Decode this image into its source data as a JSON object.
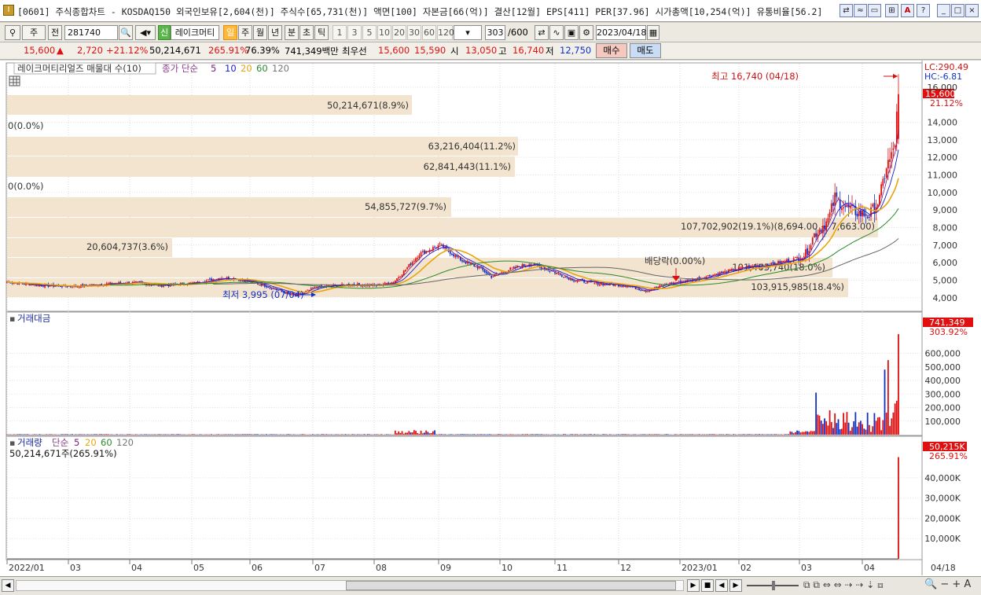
{
  "window": {
    "title": "[0601] 주식종합차트 - KOSDAQ150 외국인보유[2,604(천)] 주식수[65,731(천)] 액면[100] 자본금[66(억)] 결산[12월] EPS[411] PER[37.96] 시가총액[10,254(억)] 유통비율[56.2]",
    "buttons": [
      "⇄",
      "≈",
      "▭",
      "⊞",
      "A",
      "?"
    ],
    "controls": [
      "_",
      "□",
      "×"
    ]
  },
  "toolbar": {
    "mode": "주",
    "prev": "전",
    "code": "281740",
    "stock_name": "레이크머티",
    "badge": "신",
    "periods": [
      "일",
      "주",
      "월",
      "년",
      "분",
      "초",
      "틱"
    ],
    "selected_period": "일",
    "intervals": [
      "1",
      "3",
      "5",
      "10",
      "20",
      "30",
      "60",
      "120"
    ],
    "count": "303",
    "count_total": "/600",
    "date": "2023/04/18"
  },
  "quote": {
    "price": "15,600",
    "arrow": "▲",
    "change": "2,720",
    "change_pct": "+21.12%",
    "volume": "50,214,671",
    "vol_pct": "265.91%",
    "turnover": "76.39%",
    "amount": "741,349백만",
    "best_label": "최우선",
    "best_ask": "15,600",
    "best_bid": "15,590",
    "open_label": "시",
    "open": "13,050",
    "high_label": "고",
    "high": "16,740",
    "low_label": "저",
    "low": "12,750",
    "buy": "매수",
    "sell": "매도"
  },
  "colors": {
    "up": "#e01010",
    "down": "#1030c8",
    "ma5": "#1a1ad0",
    "ma20": "#e8a40c",
    "ma60": "#2a8a2a",
    "ma120": "#666666",
    "vp_band": "#f3e4d0"
  },
  "price_panel": {
    "legend_title": "레이크머티리얼즈 매물대 수(10)",
    "legend_ma_label": "종가 단순",
    "legend_ma": [
      "5",
      "10",
      "20",
      "60",
      "120"
    ],
    "lc": "LC:290.49",
    "hc": "HC:-6.81",
    "last_price": "15,600",
    "last_pct": "21.12%",
    "high_note": "최고 16,740 (04/18)",
    "low_note": "최저 3,995 (07/04)",
    "div_note": "배당락(0.00%)",
    "y_ticks": [
      "16,000",
      "14,000",
      "13,000",
      "12,000",
      "11,000",
      "10,000",
      "9,000",
      "8,000",
      "7,000",
      "6,000",
      "5,000",
      "4,000"
    ],
    "vp_labels": [
      "50,214,671(8.9%)",
      "0(0.0%)",
      "63,216,404(11.2%)",
      "62,841,443(11.1%)",
      "0(0.0%)",
      "54,855,727(9.7%)",
      "107,702,902(19.1%)(8,694.00 ~ 7,663.00)",
      "20,604,737(3.6%)",
      "101,463,740(18.0%)",
      "103,915,985(18.4%)"
    ]
  },
  "amount_panel": {
    "title": "거래대금",
    "last": "741,349",
    "last_pct": "303.92%",
    "y_ticks": [
      "600,000",
      "500,000",
      "400,000",
      "300,000",
      "200,000",
      "100,000"
    ]
  },
  "volume_panel": {
    "title": "거래량",
    "ma_label": "단순",
    "ma": [
      "5",
      "20",
      "60",
      "120"
    ],
    "info": "50,214,671주(265.91%)",
    "last": "50,215K",
    "last_pct": "265.91%",
    "y_ticks": [
      "40,000K",
      "30,000K",
      "20,000K",
      "10,000K"
    ]
  },
  "x_axis": {
    "labels": [
      "2022/01",
      "03",
      "04",
      "05",
      "06",
      "07",
      "08",
      "09",
      "10",
      "11",
      "12",
      "2023/01",
      "02",
      "03",
      "04"
    ],
    "end_label": "04/18"
  },
  "chart_data": {
    "type": "candlestick",
    "price_range": [
      3900,
      16800
    ],
    "highlights": {
      "high": 16740,
      "high_date": "04/18",
      "low": 3995,
      "low_date": "07/04"
    },
    "last_candle": {
      "open": 13050,
      "high": 16740,
      "low": 12750,
      "close": 15600
    },
    "volume_profile": [
      {
        "value": 50214671,
        "pct": 8.9
      },
      {
        "value": 0,
        "pct": 0.0
      },
      {
        "value": 63216404,
        "pct": 11.2
      },
      {
        "value": 62841443,
        "pct": 11.1
      },
      {
        "value": 0,
        "pct": 0.0
      },
      {
        "value": 54855727,
        "pct": 9.7
      },
      {
        "value": 107702902,
        "pct": 19.1,
        "range": [
          8694,
          7663
        ]
      },
      {
        "value": 20604737,
        "pct": 3.6
      },
      {
        "value": 101463740,
        "pct": 18.0
      },
      {
        "value": 103915985,
        "pct": 18.4
      }
    ],
    "price_anchors": [
      [
        0,
        4900
      ],
      [
        20,
        4700
      ],
      [
        40,
        4650
      ],
      [
        60,
        4800
      ],
      [
        75,
        4850
      ],
      [
        90,
        4700
      ],
      [
        110,
        4850
      ],
      [
        125,
        5150
      ],
      [
        135,
        5050
      ],
      [
        150,
        4700
      ],
      [
        160,
        4350
      ],
      [
        168,
        4100
      ],
      [
        180,
        4600
      ],
      [
        200,
        4750
      ],
      [
        215,
        4700
      ],
      [
        225,
        4900
      ],
      [
        232,
        5600
      ],
      [
        240,
        6500
      ],
      [
        252,
        7000
      ],
      [
        265,
        6100
      ],
      [
        275,
        5700
      ],
      [
        282,
        5200
      ],
      [
        295,
        5700
      ],
      [
        305,
        5950
      ],
      [
        315,
        5600
      ],
      [
        330,
        5000
      ],
      [
        345,
        4800
      ],
      [
        360,
        4700
      ],
      [
        372,
        4400
      ],
      [
        385,
        4800
      ],
      [
        400,
        5050
      ],
      [
        415,
        5400
      ],
      [
        430,
        5750
      ],
      [
        445,
        5900
      ],
      [
        458,
        6200
      ],
      [
        465,
        6500
      ],
      [
        470,
        7600
      ],
      [
        478,
        8400
      ],
      [
        482,
        9700
      ],
      [
        488,
        9200
      ],
      [
        496,
        8800
      ],
      [
        502,
        8700
      ],
      [
        508,
        9600
      ],
      [
        512,
        11500
      ],
      [
        515,
        12000
      ],
      [
        517,
        12900
      ],
      [
        519,
        15600
      ]
    ],
    "amount_ymax": 741349,
    "volume_ymax_k": 50215
  }
}
